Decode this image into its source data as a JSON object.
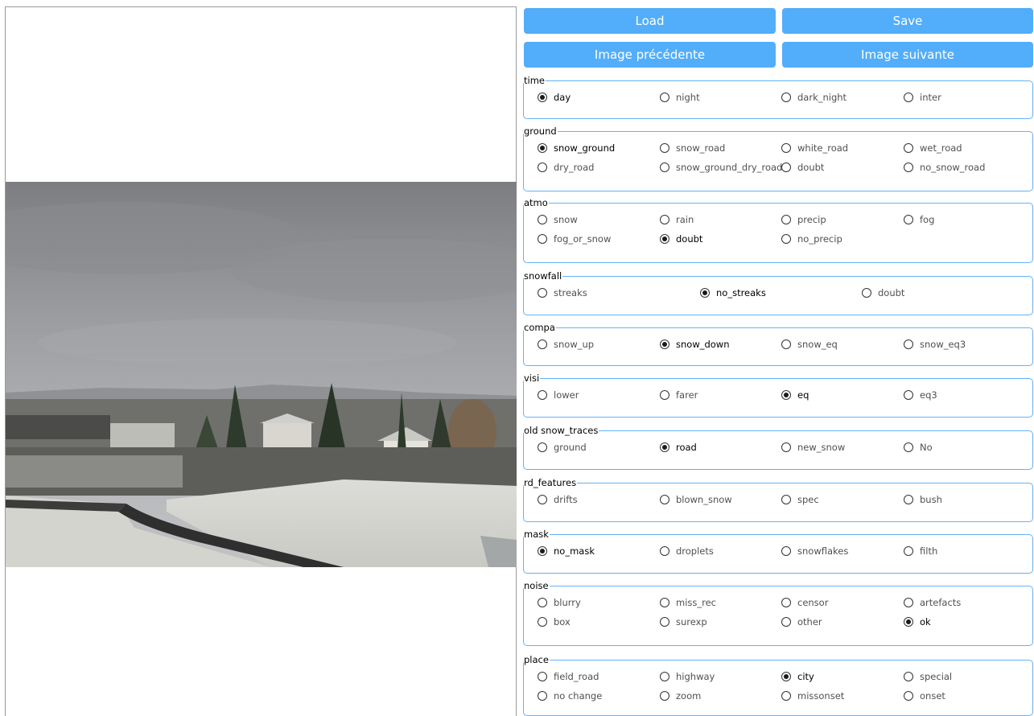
{
  "buttons": {
    "load": "Load",
    "save": "Save",
    "prev": "Image précédente",
    "next": "Image suivante"
  },
  "groups": [
    {
      "title": "time",
      "rows": 1,
      "cols": 4,
      "options": [
        {
          "label": "day",
          "checked": true
        },
        {
          "label": "night",
          "checked": false
        },
        {
          "label": "dark_night",
          "checked": false
        },
        {
          "label": "inter",
          "checked": false
        }
      ]
    },
    {
      "title": "ground",
      "rows": 2,
      "cols": 4,
      "options": [
        {
          "label": "snow_ground",
          "checked": true
        },
        {
          "label": "snow_road",
          "checked": false
        },
        {
          "label": "white_road",
          "checked": false
        },
        {
          "label": "wet_road",
          "checked": false
        },
        {
          "label": "dry_road",
          "checked": false
        },
        {
          "label": "snow_ground_dry_road",
          "checked": false
        },
        {
          "label": "doubt",
          "checked": false
        },
        {
          "label": "no_snow_road",
          "checked": false
        }
      ]
    },
    {
      "title": "atmo",
      "rows": 2,
      "cols": 4,
      "options": [
        {
          "label": "snow",
          "checked": false
        },
        {
          "label": "rain",
          "checked": false
        },
        {
          "label": "precip",
          "checked": false
        },
        {
          "label": "fog",
          "checked": false
        },
        {
          "label": "fog_or_snow",
          "checked": false
        },
        {
          "label": "doubt",
          "checked": true
        },
        {
          "label": "no_precip",
          "checked": false
        }
      ]
    },
    {
      "title": "snowfall",
      "rows": 1,
      "cols": 3,
      "options": [
        {
          "label": "streaks",
          "checked": false
        },
        {
          "label": "no_streaks",
          "checked": true
        },
        {
          "label": "doubt",
          "checked": false
        }
      ]
    },
    {
      "title": "compa",
      "rows": 1,
      "cols": 4,
      "options": [
        {
          "label": "snow_up",
          "checked": false
        },
        {
          "label": "snow_down",
          "checked": true
        },
        {
          "label": "snow_eq",
          "checked": false
        },
        {
          "label": "snow_eq3",
          "checked": false
        }
      ]
    },
    {
      "title": "visi",
      "rows": 1,
      "cols": 4,
      "options": [
        {
          "label": "lower",
          "checked": false
        },
        {
          "label": "farer",
          "checked": false
        },
        {
          "label": "eq",
          "checked": true
        },
        {
          "label": "eq3",
          "checked": false
        }
      ]
    },
    {
      "title": "old snow_traces",
      "rows": 1,
      "cols": 4,
      "options": [
        {
          "label": "ground",
          "checked": false
        },
        {
          "label": "road",
          "checked": true
        },
        {
          "label": "new_snow",
          "checked": false
        },
        {
          "label": "No",
          "checked": false
        }
      ]
    },
    {
      "title": "rd_features",
      "rows": 1,
      "cols": 4,
      "options": [
        {
          "label": "drifts",
          "checked": false
        },
        {
          "label": "blown_snow",
          "checked": false
        },
        {
          "label": "spec",
          "checked": false
        },
        {
          "label": "bush",
          "checked": false
        }
      ]
    },
    {
      "title": "mask",
      "rows": 1,
      "cols": 4,
      "options": [
        {
          "label": "no_mask",
          "checked": true
        },
        {
          "label": "droplets",
          "checked": false
        },
        {
          "label": "snowflakes",
          "checked": false
        },
        {
          "label": "filth",
          "checked": false
        }
      ]
    },
    {
      "title": "noise",
      "rows": 2,
      "cols": 4,
      "options": [
        {
          "label": "blurry",
          "checked": false
        },
        {
          "label": "miss_rec",
          "checked": false
        },
        {
          "label": "censor",
          "checked": false
        },
        {
          "label": "artefacts",
          "checked": false
        },
        {
          "label": "box",
          "checked": false
        },
        {
          "label": "surexp",
          "checked": false
        },
        {
          "label": "other",
          "checked": false
        },
        {
          "label": "ok",
          "checked": true
        }
      ]
    },
    {
      "title": "place",
      "rows": 2,
      "cols": 4,
      "options": [
        {
          "label": "field_road",
          "checked": false
        },
        {
          "label": "highway",
          "checked": false
        },
        {
          "label": "city",
          "checked": true
        },
        {
          "label": "special",
          "checked": false
        },
        {
          "label": "no change",
          "checked": false
        },
        {
          "label": "zoom",
          "checked": false
        },
        {
          "label": "missonset",
          "checked": false
        },
        {
          "label": "onset",
          "checked": false
        }
      ]
    }
  ],
  "colors": {
    "button": "#52aefa",
    "group_border": "#62b3f7"
  }
}
